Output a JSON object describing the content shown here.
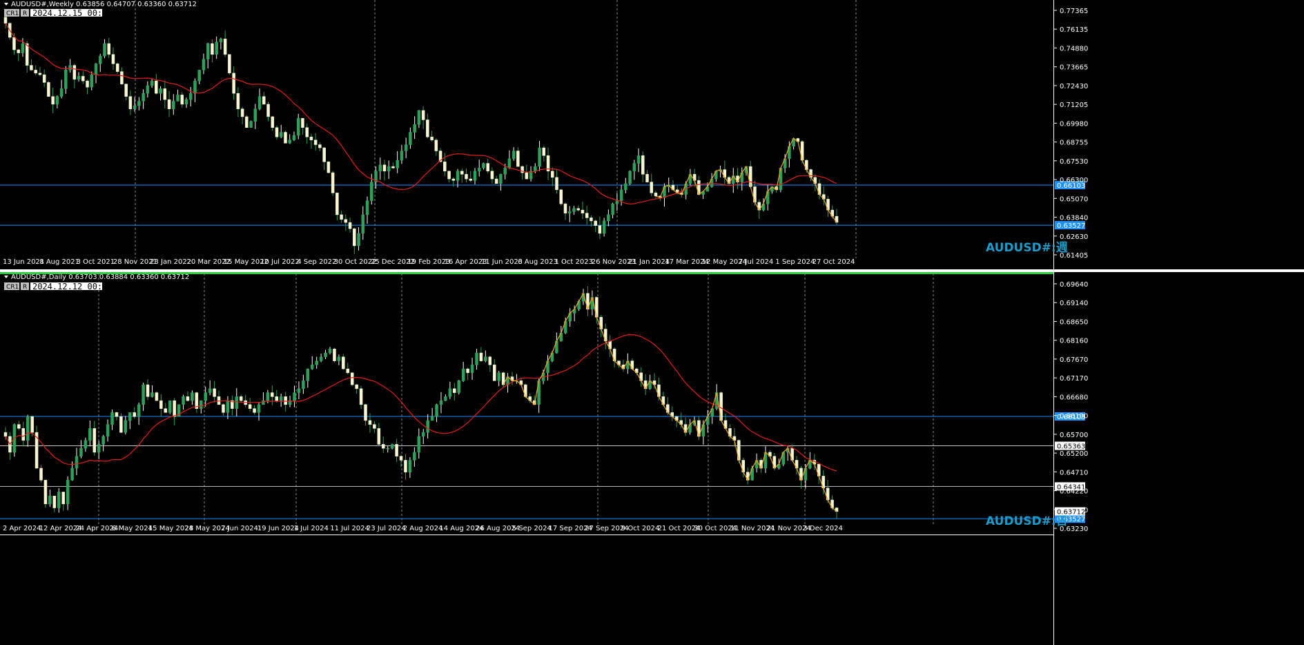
{
  "chart_data": [
    {
      "type": "candlestick",
      "symbol": "AUDUSD#",
      "timeframe": "Weekly",
      "header": "AUDUSD#,Weekly  0.63856 0.64707 0.63360 0.63712",
      "ohlc": {
        "open": 0.63856,
        "high": 0.64707,
        "low": 0.6336,
        "close": 0.63712
      },
      "buttons": [
        "CR1",
        "R"
      ],
      "time_box": "2024.12.15 00:00",
      "watermark": "AUDUSD#:週",
      "ylim": [
        0.614,
        0.78
      ],
      "price_ticks": [
        "0.77365",
        "0.76135",
        "0.74880",
        "0.73665",
        "0.72430",
        "0.71205",
        "0.69980",
        "0.68755",
        "0.67530",
        "0.66300",
        "0.65070",
        "0.63840",
        "0.62630",
        "0.61405"
      ],
      "date_ticks": [
        "13 Jun 2021",
        "8 Aug 2021",
        "3 Oct 2021",
        "28 Nov 2021",
        "23 Jan 2022",
        "20 Mar 2022",
        "15 May 2022",
        "10 Jul 2022",
        "4 Sep 2022",
        "30 Oct 2022",
        "25 Dec 2022",
        "19 Feb 2023",
        "16 Apr 2023",
        "11 Jun 2023",
        "6 Aug 2023",
        "1 Oct 2023",
        "26 Nov 2023",
        "21 Jan 2024",
        "17 Mar 2024",
        "12 May 2024",
        "7 Jul 2024",
        "1 Sep 2024",
        "27 Oct 2024"
      ],
      "hlines": [
        {
          "price": 0.66103,
          "label": "0.66103",
          "color": "#1e90ff"
        },
        {
          "price": 0.63527,
          "label": "0.63527",
          "color": "#1e90ff"
        }
      ],
      "closes": [
        0.765,
        0.756,
        0.748,
        0.746,
        0.752,
        0.738,
        0.735,
        0.733,
        0.732,
        0.727,
        0.718,
        0.713,
        0.718,
        0.723,
        0.735,
        0.738,
        0.729,
        0.731,
        0.728,
        0.724,
        0.732,
        0.739,
        0.744,
        0.752,
        0.745,
        0.739,
        0.734,
        0.726,
        0.718,
        0.71,
        0.712,
        0.715,
        0.72,
        0.725,
        0.728,
        0.72,
        0.723,
        0.716,
        0.71,
        0.715,
        0.719,
        0.713,
        0.716,
        0.72,
        0.728,
        0.735,
        0.742,
        0.752,
        0.745,
        0.753,
        0.755,
        0.745,
        0.733,
        0.72,
        0.71,
        0.705,
        0.698,
        0.702,
        0.71,
        0.718,
        0.713,
        0.705,
        0.698,
        0.692,
        0.695,
        0.688,
        0.69,
        0.693,
        0.704,
        0.698,
        0.692,
        0.69,
        0.687,
        0.685,
        0.676,
        0.669,
        0.656,
        0.642,
        0.639,
        0.637,
        0.633,
        0.622,
        0.63,
        0.642,
        0.651,
        0.663,
        0.67,
        0.674,
        0.67,
        0.673,
        0.672,
        0.677,
        0.683,
        0.687,
        0.695,
        0.7,
        0.709,
        0.703,
        0.692,
        0.69,
        0.683,
        0.676,
        0.67,
        0.665,
        0.664,
        0.67,
        0.668,
        0.665,
        0.664,
        0.67,
        0.672,
        0.675,
        0.67,
        0.665,
        0.662,
        0.668,
        0.672,
        0.678,
        0.683,
        0.673,
        0.669,
        0.665,
        0.67,
        0.673,
        0.685,
        0.68,
        0.67,
        0.666,
        0.658,
        0.649,
        0.643,
        0.644,
        0.646,
        0.645,
        0.643,
        0.64,
        0.638,
        0.635,
        0.63,
        0.638,
        0.642,
        0.649,
        0.651,
        0.658,
        0.662,
        0.67,
        0.675,
        0.68,
        0.668,
        0.663,
        0.656,
        0.654,
        0.653,
        0.66,
        0.661,
        0.658,
        0.656,
        0.655,
        0.662,
        0.668,
        0.664,
        0.655,
        0.657,
        0.66,
        0.665,
        0.67,
        0.671,
        0.666,
        0.662,
        0.667,
        0.663,
        0.669,
        0.673,
        0.66,
        0.65,
        0.645,
        0.649,
        0.657,
        0.66,
        0.658,
        0.672,
        0.678,
        0.686,
        0.691,
        0.689,
        0.677,
        0.671,
        0.666,
        0.662,
        0.655,
        0.652,
        0.645,
        0.641,
        0.6371
      ],
      "ma_series": "moving average (red)",
      "zigzag": "orange"
    },
    {
      "type": "candlestick",
      "symbol": "AUDUSD#",
      "timeframe": "Daily",
      "header": "AUDUSD#,Daily  0.63703 0.63884 0.63360 0.63712",
      "ohlc": {
        "open": 0.63703,
        "high": 0.63884,
        "low": 0.6336,
        "close": 0.63712
      },
      "buttons": [
        "CR1",
        "R"
      ],
      "time_box": "2024.12.12 00:00",
      "watermark": "AUDUSD#:日",
      "ylim": [
        0.632,
        0.697
      ],
      "price_ticks": [
        "0.69640",
        "0.69140",
        "0.68650",
        "0.68160",
        "0.67670",
        "0.67170",
        "0.66680",
        "0.66190",
        "0.65700",
        "0.65200",
        "0.64710",
        "0.64220",
        "0.63730",
        "0.63230"
      ],
      "date_ticks": [
        "2 Apr 2024",
        "12 Apr 2024",
        "24 Apr 2024",
        "6 May 2024",
        "15 May 2024",
        "28 May 2024",
        "7 Jun 2024",
        "19 Jun 2024",
        "1 Jul 2024",
        "11 Jul 2024",
        "23 Jul 2024",
        "2 Aug 2024",
        "14 Aug 2024",
        "26 Aug 2024",
        "5 Sep 2024",
        "17 Sep 2024",
        "27 Sep 2024",
        "9 Oct 2024",
        "21 Oct 2024",
        "30 Oct 2024",
        "11 Nov 2024",
        "21 Nov 2024",
        "3 Dec 2024"
      ],
      "hlines": [
        {
          "price": 0.66103,
          "label": "0.66103",
          "color": "#1e90ff"
        },
        {
          "price": 0.65363,
          "label": "0.65363",
          "color": "#c8c8c8"
        },
        {
          "price": 0.64341,
          "label": "0.64341",
          "color": "#c8c8c8"
        },
        {
          "price": 0.63527,
          "label": "0.63527",
          "color": "#1e90ff"
        }
      ],
      "price_labels": [
        "0.63712"
      ],
      "closes": [
        0.656,
        0.652,
        0.659,
        0.658,
        0.655,
        0.661,
        0.657,
        0.648,
        0.645,
        0.639,
        0.641,
        0.638,
        0.642,
        0.639,
        0.645,
        0.648,
        0.651,
        0.653,
        0.655,
        0.658,
        0.652,
        0.654,
        0.656,
        0.659,
        0.662,
        0.661,
        0.657,
        0.66,
        0.662,
        0.661,
        0.664,
        0.669,
        0.666,
        0.667,
        0.665,
        0.663,
        0.662,
        0.665,
        0.661,
        0.664,
        0.666,
        0.665,
        0.667,
        0.663,
        0.665,
        0.667,
        0.668,
        0.666,
        0.664,
        0.662,
        0.665,
        0.663,
        0.666,
        0.665,
        0.664,
        0.663,
        0.662,
        0.664,
        0.665,
        0.667,
        0.666,
        0.665,
        0.666,
        0.664,
        0.665,
        0.667,
        0.668,
        0.67,
        0.673,
        0.674,
        0.675,
        0.676,
        0.677,
        0.678,
        0.675,
        0.676,
        0.673,
        0.672,
        0.669,
        0.668,
        0.664,
        0.66,
        0.659,
        0.658,
        0.654,
        0.653,
        0.653,
        0.654,
        0.651,
        0.65,
        0.647,
        0.65,
        0.652,
        0.656,
        0.657,
        0.66,
        0.661,
        0.664,
        0.665,
        0.666,
        0.668,
        0.667,
        0.67,
        0.673,
        0.672,
        0.674,
        0.677,
        0.675,
        0.676,
        0.674,
        0.67,
        0.672,
        0.669,
        0.671,
        0.67,
        0.67,
        0.669,
        0.666,
        0.665,
        0.664,
        0.67,
        0.672,
        0.675,
        0.677,
        0.68,
        0.682,
        0.685,
        0.687,
        0.688,
        0.69,
        0.692,
        0.688,
        0.691,
        0.686,
        0.683,
        0.68,
        0.678,
        0.675,
        0.674,
        0.673,
        0.675,
        0.673,
        0.672,
        0.67,
        0.668,
        0.67,
        0.669,
        0.666,
        0.664,
        0.662,
        0.661,
        0.66,
        0.659,
        0.657,
        0.659,
        0.66,
        0.656,
        0.659,
        0.661,
        0.663,
        0.667,
        0.66,
        0.658,
        0.656,
        0.655,
        0.65,
        0.647,
        0.645,
        0.648,
        0.65,
        0.648,
        0.652,
        0.651,
        0.648,
        0.649,
        0.652,
        0.653,
        0.65,
        0.648,
        0.645,
        0.648,
        0.65,
        0.649,
        0.646,
        0.643,
        0.64,
        0.638,
        0.6371
      ]
    }
  ]
}
